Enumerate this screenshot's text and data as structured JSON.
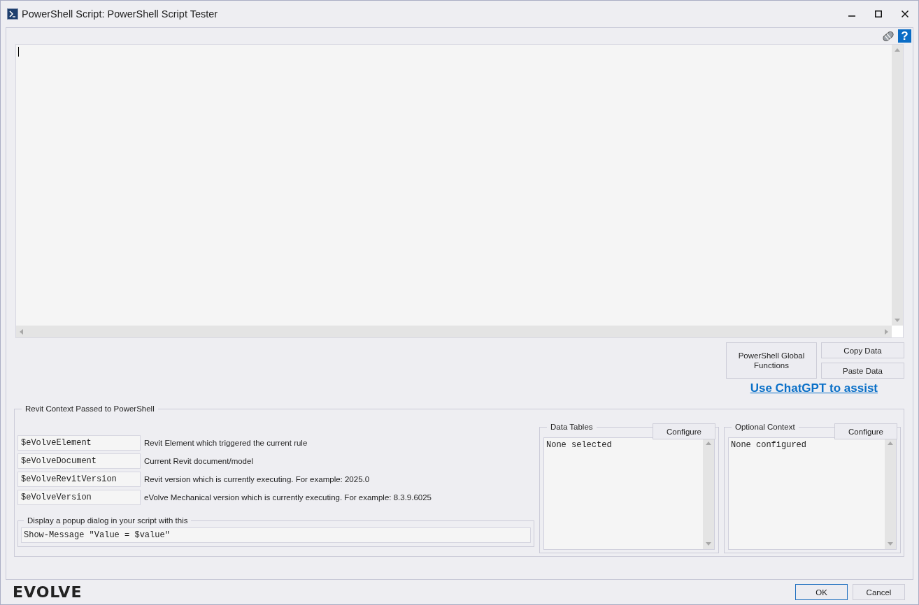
{
  "window": {
    "title": "PowerShell Script: PowerShell Script Tester"
  },
  "help_button": "?",
  "actions": {
    "functions_button": "PowerShell Global Functions",
    "copy_button": "Copy Data",
    "paste_button": "Paste Data",
    "assist_link": "Use ChatGPT to assist"
  },
  "context": {
    "title": "Revit Context Passed to PowerShell",
    "variables": [
      {
        "name": "$eVolveElement",
        "description": "Revit Element which triggered the current rule"
      },
      {
        "name": "$eVolveDocument",
        "description": "Current Revit document/model"
      },
      {
        "name": "$eVolveRevitVersion",
        "description": "Revit version which is currently executing. For example: 2025.0"
      },
      {
        "name": "$eVolveVersion",
        "description": "eVolve Mechanical version which is currently executing. For example: 8.3.9.6025"
      }
    ],
    "popup": {
      "title": "Display a popup dialog in your script with this",
      "value": "Show-Message \"Value = $value\""
    },
    "panels": [
      {
        "title": "Data Tables",
        "button": "Configure",
        "value": "None selected"
      },
      {
        "title": "Optional Context",
        "button": "Configure",
        "value": "None configured"
      }
    ]
  },
  "logo": "EVOLVE",
  "buttons": [
    {
      "label": "OK",
      "default": true
    },
    {
      "label": "Cancel",
      "default": false
    }
  ]
}
